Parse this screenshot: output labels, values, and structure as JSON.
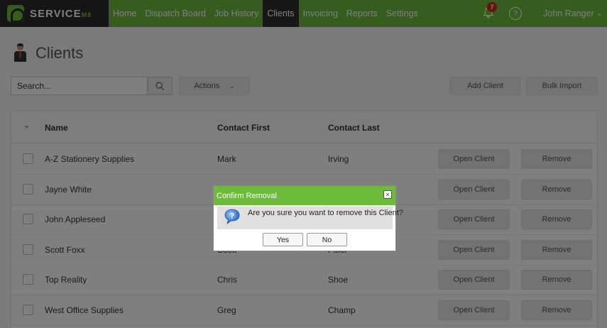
{
  "app": {
    "logo_text": "SERVICE",
    "logo_suffix": "M8"
  },
  "nav": {
    "items": [
      "Home",
      "Dispatch Board",
      "Job History",
      "Clients",
      "Invoicing",
      "Reports",
      "Settings"
    ],
    "active": "Clients",
    "notifications_count": "7",
    "help_label": "?",
    "user_name": "John Ranger"
  },
  "page": {
    "title": "Clients"
  },
  "toolbar": {
    "search_placeholder": "Search...",
    "actions_label": "Actions",
    "add_client_label": "Add Client",
    "bulk_import_label": "Bulk Import"
  },
  "table": {
    "headers": {
      "name": "Name",
      "contact_first": "Contact First",
      "contact_last": "Contact Last"
    },
    "rows": [
      {
        "name": "A-Z Stationery Supplies",
        "first": "Mark",
        "last": "Irving"
      },
      {
        "name": "Jayne White",
        "first": "",
        "last": ""
      },
      {
        "name": "John Appleseed",
        "first": "",
        "last": ""
      },
      {
        "name": "Scott Foxx",
        "first": "Scott",
        "last": "Foxx"
      },
      {
        "name": "Top Reality",
        "first": "Chris",
        "last": "Shoe"
      },
      {
        "name": "West Office Supplies",
        "first": "Greg",
        "last": "Champ"
      }
    ],
    "open_label": "Open Client",
    "remove_label": "Remove"
  },
  "modal": {
    "title": "Confirm Removal",
    "message": "Are you sure you want to remove this Client?",
    "yes_label": "Yes",
    "no_label": "No",
    "close_label": "×"
  },
  "colors": {
    "brand_green": "#6dbb3b",
    "dark": "#2b2b2b",
    "badge_red": "#d0201b"
  }
}
